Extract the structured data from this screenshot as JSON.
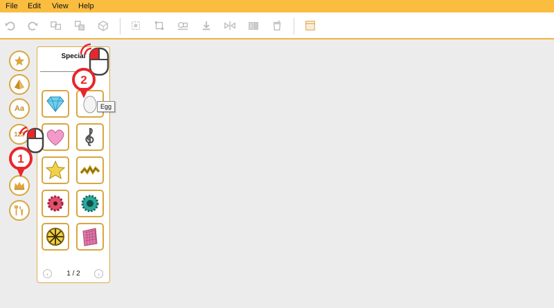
{
  "menubar": {
    "items": [
      "File",
      "Edit",
      "View",
      "Help"
    ]
  },
  "toolbar": {
    "icons": [
      "undo-icon",
      "redo-icon",
      "copy-shape-icon",
      "paste-shape-icon",
      "duplicate-shape-icon",
      "select-points-icon",
      "transform-icon",
      "measure-icon",
      "download-icon",
      "mirror-icon",
      "split-icon",
      "delete-icon",
      "table-icon"
    ]
  },
  "sidebar": {
    "icons": [
      "star-icon",
      "pyramid-icon",
      "text-aa-icon",
      "numbers-123-icon",
      "crown-icon",
      "tools-icon"
    ],
    "labels": {
      "text": "Aa",
      "numbers": "123"
    }
  },
  "panel": {
    "title": "Special",
    "items": [
      "gem",
      "egg",
      "heart",
      "treble-clef",
      "star",
      "twisted-gold",
      "red-gear",
      "teal-gear",
      "gold-wheel",
      "pink-grid"
    ],
    "tooltip": "Egg",
    "pager": {
      "current": "1",
      "separator": "/",
      "total": "2"
    }
  },
  "callouts": {
    "first": "1",
    "second": "2"
  },
  "colors": {
    "accent": "#fbbd3f",
    "border": "#d9a640",
    "callout": "#e8262b"
  }
}
